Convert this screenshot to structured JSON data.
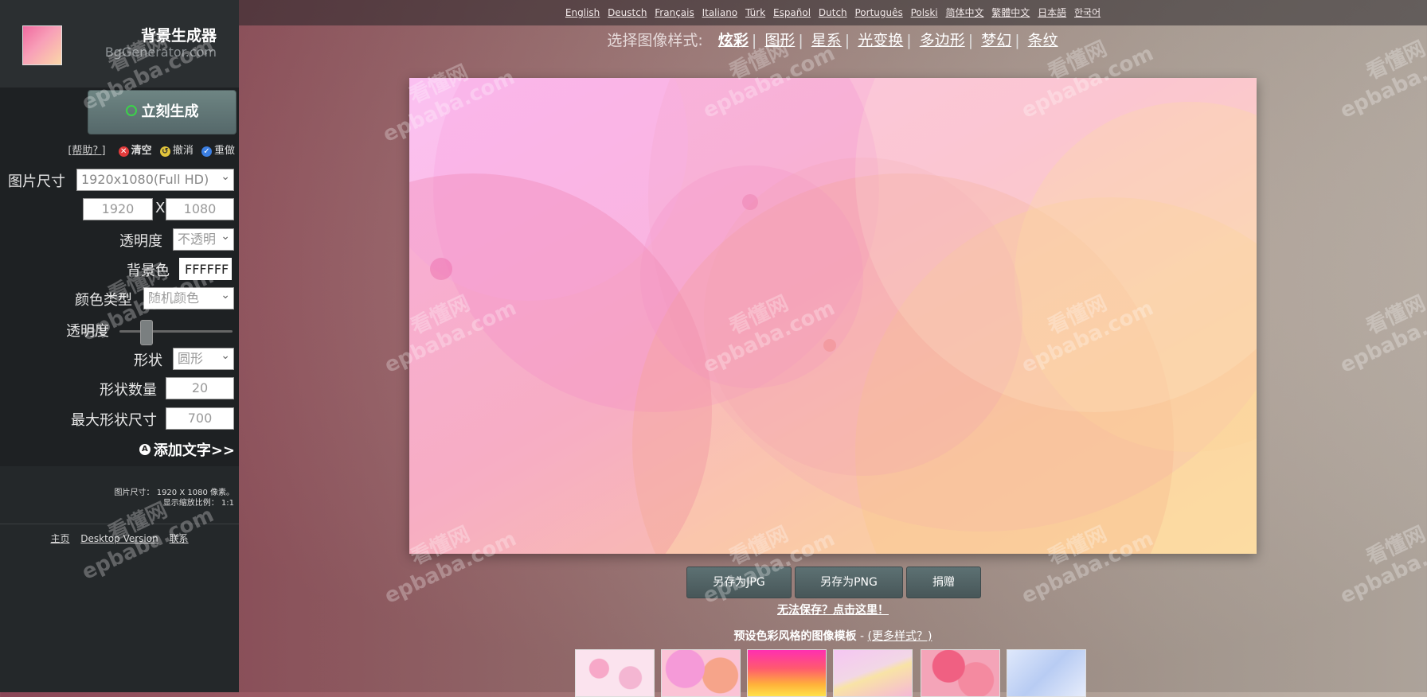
{
  "app": {
    "title": "背景生成器",
    "subtitle": "BgGenerator.com"
  },
  "controls": {
    "generate_label": "立刻生成",
    "help_label": "[帮助? ]",
    "clear_label": "清空",
    "undo_label": "撤消",
    "redo_label": "重做",
    "image_size_label": "图片尺寸",
    "image_size_value": "1920x1080(Full HD)",
    "width_value": "1920",
    "x_label": "X",
    "height_value": "1080",
    "transparency_label": "透明度",
    "transparency_value": "不透明",
    "bgcolor_label": "背景色",
    "bgcolor_value": "FFFFFF",
    "color_type_label": "颜色类型",
    "color_type_value": "随机颜色",
    "opacity_label": "透明度",
    "opacity_level": 0.2,
    "shape_label": "形状",
    "shape_value": "圆形",
    "shape_count_label": "形状数量",
    "shape_count_value": "20",
    "max_shape_size_label": "最大形状尺寸",
    "max_shape_size_value": "700",
    "add_text_label": "添加文字>>"
  },
  "info": {
    "line1": "图片尺寸： 1920 X 1080 像素。",
    "line2": "显示缩放比例： 1:1"
  },
  "footer_links": [
    "主页",
    "Desktop Version",
    "联系"
  ],
  "languages": [
    "English",
    "Deustch",
    "Français",
    "Italiano",
    "Türk",
    "Español",
    "Dutch",
    "Português",
    "Polski",
    "简体中文",
    "繁體中文",
    "日本語",
    "한국어"
  ],
  "styles": {
    "prompt": "选择图像样式:",
    "items": [
      "炫彩",
      "图形",
      "星系",
      "光变换",
      "多边形",
      "梦幻",
      "条纹"
    ],
    "active": "炫彩"
  },
  "buttons": {
    "save_jpg": "另存为JPG",
    "save_png": "另存为PNG",
    "donate": "捐赠"
  },
  "cant_save": "无法保存？点击这里！",
  "templates": {
    "title": "预设色彩风格的图像模板",
    "sep": " - ",
    "more": "(更多样式？)"
  },
  "watermark": {
    "line1": "看懂网",
    "line2": "epbaba.com"
  },
  "colors": {
    "sidebar_bg": "#24282a",
    "button_bg": "#55686a",
    "accent_green": "#3cd14a"
  }
}
